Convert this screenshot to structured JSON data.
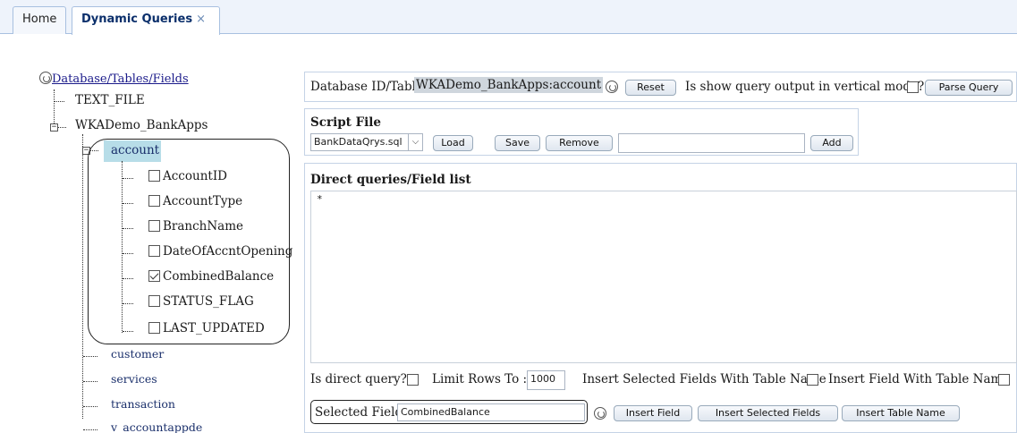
{
  "tabs": [
    {
      "label": "Home"
    },
    {
      "label": "Dynamic Queries",
      "close": "×"
    }
  ],
  "tree": {
    "root_label": "Database/Tables/Fields",
    "nodes": {
      "text_file": "TEXT_FILE",
      "db": "WKADemo_BankApps",
      "account": "account",
      "customer": "customer",
      "services": "services",
      "transaction": "transaction",
      "v_account": "v_accountappde"
    },
    "fields": [
      {
        "label": "AccountID",
        "checked": false
      },
      {
        "label": "AccountType",
        "checked": false
      },
      {
        "label": "BranchName",
        "checked": false
      },
      {
        "label": "DateOfAccntOpening",
        "checked": false
      },
      {
        "label": "CombinedBalance",
        "checked": true
      },
      {
        "label": "STATUS_FLAG",
        "checked": false
      },
      {
        "label": "LAST_UPDATED",
        "checked": false
      }
    ]
  },
  "top": {
    "db_table_label": "Database ID/Table:",
    "db_table_value": "WKADemo_BankApps:account",
    "reset": "Reset",
    "vertical_label": "Is show query output in vertical mode?",
    "parse": "Parse Query"
  },
  "script": {
    "title": "Script File",
    "file": "BankDataQrys.sql",
    "load": "Load",
    "save": "Save",
    "remove": "Remove",
    "name_value": "",
    "add": "Add"
  },
  "direct": {
    "title": "Direct queries/Field list",
    "text": "*"
  },
  "options": {
    "direct_query": "Is direct query?",
    "limit_rows": "Limit Rows To :",
    "limit_value": "1000",
    "insert_selected_with_table": "Insert Selected Fields With Table Name",
    "insert_field_with_table": "Insert Field With Table Name"
  },
  "selected": {
    "label": "Selected Field:",
    "value": "CombinedBalance",
    "insert_field": "Insert Field",
    "insert_selected": "Insert Selected Fields",
    "insert_table": "Insert Table Name"
  }
}
